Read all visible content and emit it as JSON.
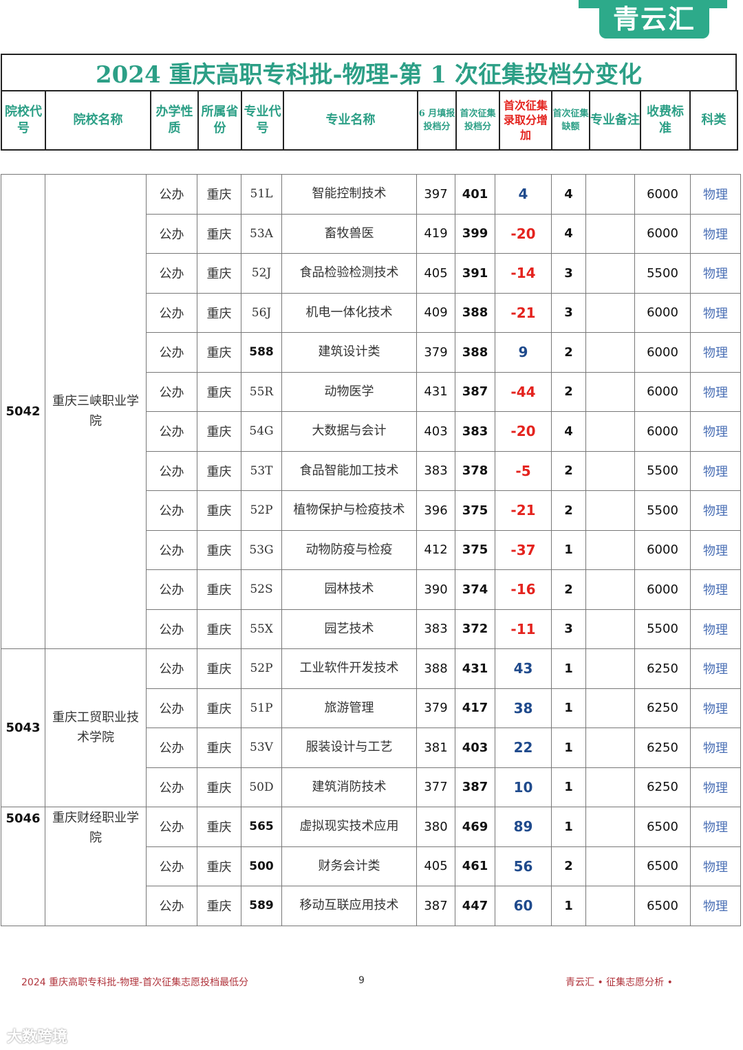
{
  "brand": {
    "name": "青云汇",
    "color": "#2daa8a"
  },
  "title": "2024 重庆高职专科批-物理-第 1 次征集投档分变化",
  "header": {
    "school_code": "院校代号",
    "school_name": "院校名称",
    "nature": "办学性质",
    "province": "所属省份",
    "major_code": "专业代号",
    "major_name": "专业名称",
    "june_score": "6 月填报投档分",
    "first_score": "首次征集投档分",
    "increase": "首次征集录取分增加",
    "vacancy": "首次征集缺额",
    "note": "专业备注",
    "fee": "收费标准",
    "subject": "科类"
  },
  "groups": [
    {
      "code": "5042",
      "name": "重庆三峡职业学院",
      "rows": [
        {
          "nature": "公办",
          "province": "重庆",
          "major_code": "51L",
          "major_name": "智能控制技术",
          "june": "397",
          "first": "401",
          "change": "4",
          "vacancy": "4",
          "note": "",
          "fee": "6000",
          "subject": "物理"
        },
        {
          "nature": "公办",
          "province": "重庆",
          "major_code": "53A",
          "major_name": "畜牧兽医",
          "june": "419",
          "first": "399",
          "change": "-20",
          "vacancy": "4",
          "note": "",
          "fee": "6000",
          "subject": "物理"
        },
        {
          "nature": "公办",
          "province": "重庆",
          "major_code": "52J",
          "major_name": "食品检验检测技术",
          "june": "405",
          "first": "391",
          "change": "-14",
          "vacancy": "3",
          "note": "",
          "fee": "5500",
          "subject": "物理"
        },
        {
          "nature": "公办",
          "province": "重庆",
          "major_code": "56J",
          "major_name": "机电一体化技术",
          "june": "409",
          "first": "388",
          "change": "-21",
          "vacancy": "3",
          "note": "",
          "fee": "6000",
          "subject": "物理"
        },
        {
          "nature": "公办",
          "province": "重庆",
          "major_code": "588",
          "major_name": "建筑设计类",
          "june": "379",
          "first": "388",
          "change": "9",
          "vacancy": "2",
          "note": "",
          "fee": "6000",
          "subject": "物理"
        },
        {
          "nature": "公办",
          "province": "重庆",
          "major_code": "55R",
          "major_name": "动物医学",
          "june": "431",
          "first": "387",
          "change": "-44",
          "vacancy": "2",
          "note": "",
          "fee": "6000",
          "subject": "物理"
        },
        {
          "nature": "公办",
          "province": "重庆",
          "major_code": "54G",
          "major_name": "大数据与会计",
          "june": "403",
          "first": "383",
          "change": "-20",
          "vacancy": "4",
          "note": "",
          "fee": "6000",
          "subject": "物理"
        },
        {
          "nature": "公办",
          "province": "重庆",
          "major_code": "53T",
          "major_name": "食品智能加工技术",
          "june": "383",
          "first": "378",
          "change": "-5",
          "vacancy": "2",
          "note": "",
          "fee": "5500",
          "subject": "物理"
        },
        {
          "nature": "公办",
          "province": "重庆",
          "major_code": "52P",
          "major_name": "植物保护与检疫技术",
          "june": "396",
          "first": "375",
          "change": "-21",
          "vacancy": "2",
          "note": "",
          "fee": "5500",
          "subject": "物理"
        },
        {
          "nature": "公办",
          "province": "重庆",
          "major_code": "53G",
          "major_name": "动物防疫与检疫",
          "june": "412",
          "first": "375",
          "change": "-37",
          "vacancy": "1",
          "note": "",
          "fee": "6000",
          "subject": "物理"
        },
        {
          "nature": "公办",
          "province": "重庆",
          "major_code": "52S",
          "major_name": "园林技术",
          "june": "390",
          "first": "374",
          "change": "-16",
          "vacancy": "2",
          "note": "",
          "fee": "6000",
          "subject": "物理"
        },
        {
          "nature": "公办",
          "province": "重庆",
          "major_code": "55X",
          "major_name": "园艺技术",
          "june": "383",
          "first": "372",
          "change": "-11",
          "vacancy": "3",
          "note": "",
          "fee": "5500",
          "subject": "物理"
        }
      ]
    },
    {
      "code": "5043",
      "name": "重庆工贸职业技术学院",
      "rows": [
        {
          "nature": "公办",
          "province": "重庆",
          "major_code": "52P",
          "major_name": "工业软件开发技术",
          "june": "388",
          "first": "431",
          "change": "43",
          "vacancy": "1",
          "note": "",
          "fee": "6250",
          "subject": "物理"
        },
        {
          "nature": "公办",
          "province": "重庆",
          "major_code": "51P",
          "major_name": "旅游管理",
          "june": "379",
          "first": "417",
          "change": "38",
          "vacancy": "1",
          "note": "",
          "fee": "6250",
          "subject": "物理"
        },
        {
          "nature": "公办",
          "province": "重庆",
          "major_code": "53V",
          "major_name": "服装设计与工艺",
          "june": "381",
          "first": "403",
          "change": "22",
          "vacancy": "1",
          "note": "",
          "fee": "6250",
          "subject": "物理"
        },
        {
          "nature": "公办",
          "province": "重庆",
          "major_code": "50D",
          "major_name": "建筑消防技术",
          "june": "377",
          "first": "387",
          "change": "10",
          "vacancy": "1",
          "note": "",
          "fee": "6250",
          "subject": "物理"
        }
      ]
    },
    {
      "code": "5046",
      "name": "重庆财经职业学院",
      "rows": [
        {
          "nature": "公办",
          "province": "重庆",
          "major_code": "565",
          "major_name": "虚拟现实技术应用",
          "june": "380",
          "first": "469",
          "change": "89",
          "vacancy": "1",
          "note": "",
          "fee": "6500",
          "subject": "物理"
        },
        {
          "nature": "公办",
          "province": "重庆",
          "major_code": "500",
          "major_name": "财务会计类",
          "june": "405",
          "first": "461",
          "change": "56",
          "vacancy": "2",
          "note": "",
          "fee": "6500",
          "subject": "物理"
        },
        {
          "nature": "公办",
          "province": "重庆",
          "major_code": "589",
          "major_name": "移动互联应用技术",
          "june": "387",
          "first": "447",
          "change": "60",
          "vacancy": "1",
          "note": "",
          "fee": "6500",
          "subject": "物理"
        }
      ]
    }
  ],
  "footer": {
    "left": "2024 重庆高职专科批-物理-首次征集志愿投档最低分",
    "page": "9",
    "right": "青云汇 • 征集志愿分析 •"
  },
  "watermark": "大数跨境"
}
